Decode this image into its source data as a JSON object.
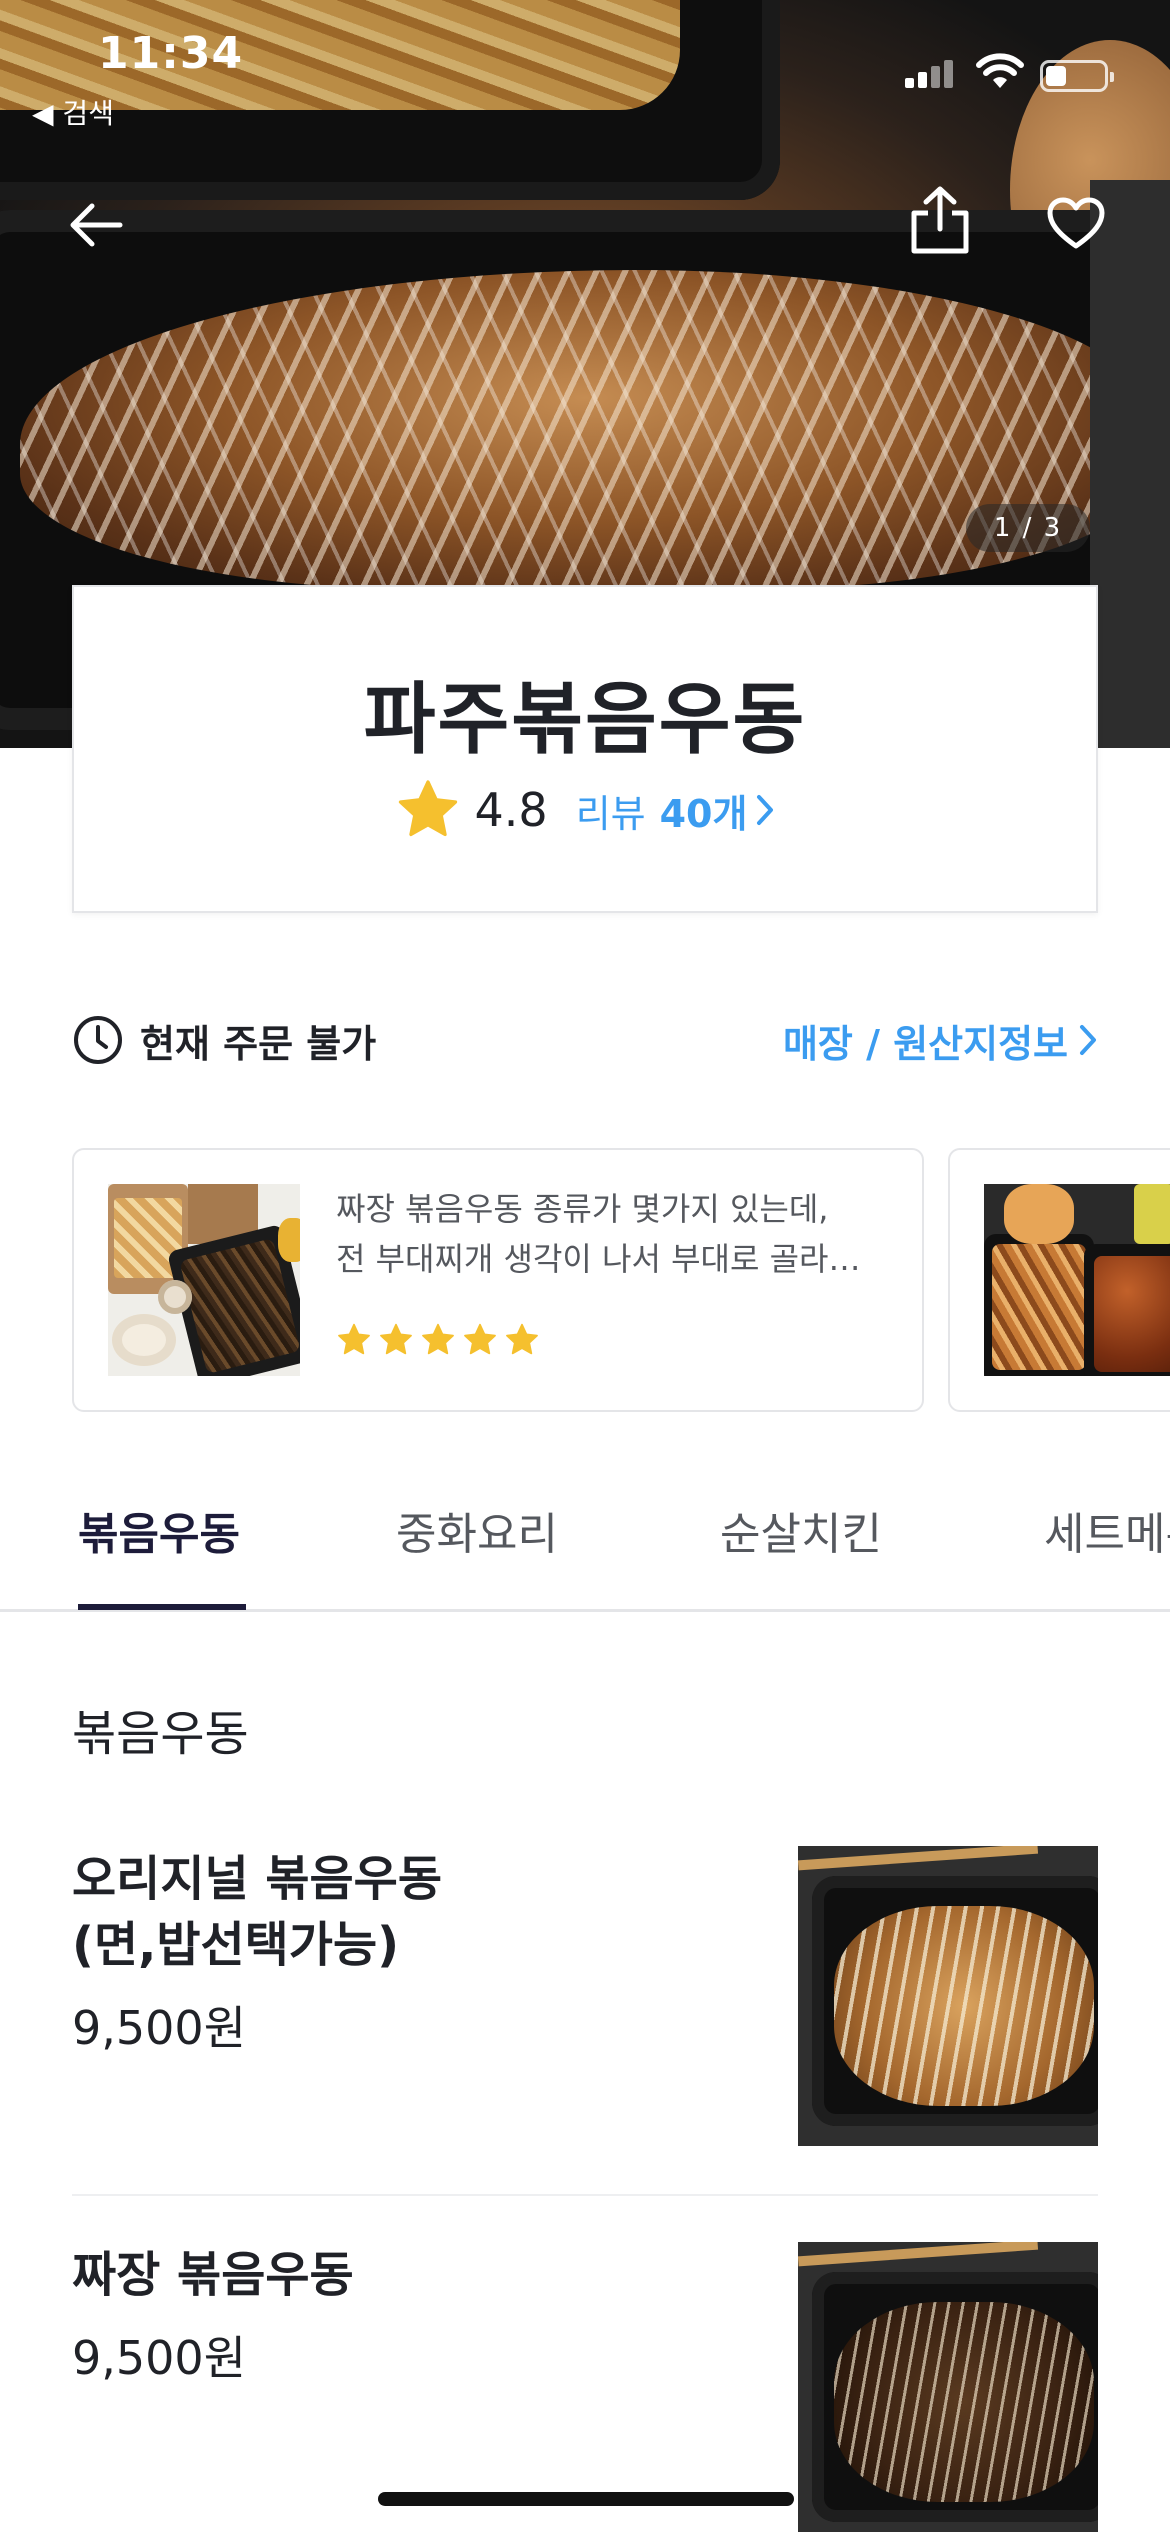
{
  "status_bar": {
    "time": "11:34",
    "back_app": "◀ 검색",
    "battery_level": 0.35
  },
  "hero": {
    "image_counter": "1 / 3"
  },
  "shop": {
    "name": "파주볶음우동",
    "rating": "4.8",
    "review_label": "리뷰",
    "review_count": "40개"
  },
  "order": {
    "status": "현재 주문 불가",
    "store_info_link": "매장 / 원산지정보"
  },
  "reviews": [
    {
      "line1": "짜장 볶음우동 종류가 몇가지 있는데,",
      "line2": "전 부대찌개 생각이 나서 부대로 골라…",
      "stars": 5
    },
    {
      "stars": 0
    }
  ],
  "tabs": [
    {
      "label": "볶음우동",
      "active": true
    },
    {
      "label": "중화요리",
      "active": false
    },
    {
      "label": "순살치킨",
      "active": false
    },
    {
      "label": "세트메뉴",
      "active": false
    }
  ],
  "menu": {
    "section_title": "볶음우동",
    "items": [
      {
        "name_line1": "오리지널 볶음우동",
        "name_line2": "(면,밥선택가능)",
        "price": "9,500원"
      },
      {
        "name_line1": "짜장 볶음우동",
        "price": "9,500원"
      }
    ]
  },
  "colors": {
    "accent_blue": "#3b9cf0",
    "star_yellow": "#f5c02e",
    "tab_active": "#1d1c3a"
  }
}
